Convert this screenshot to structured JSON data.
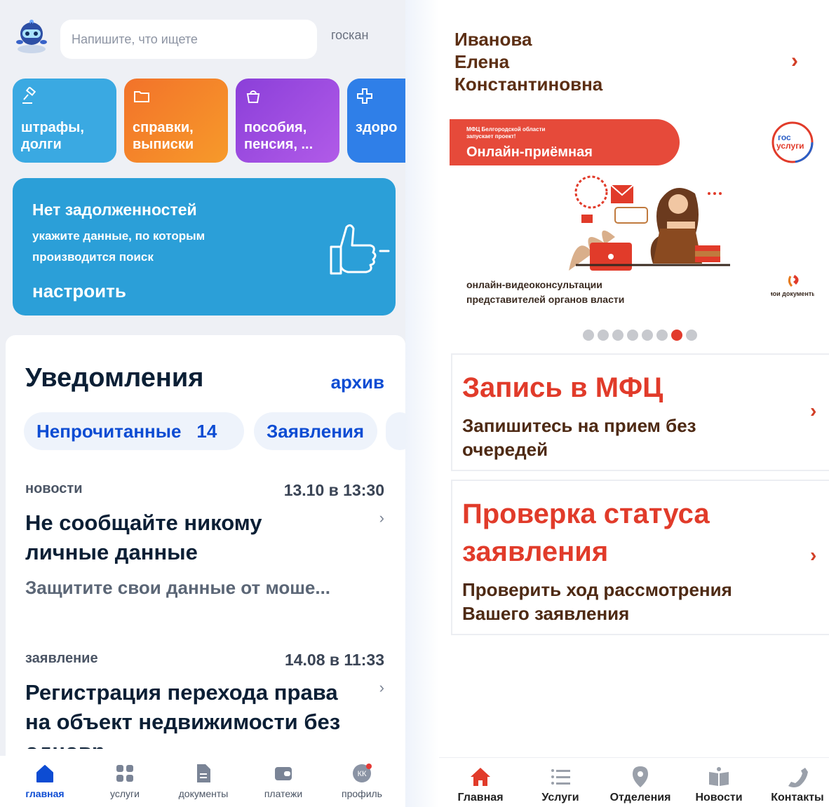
{
  "left": {
    "search": {
      "placeholder": "Напишите, что ищете",
      "scan_label": "госкан"
    },
    "tiles": [
      {
        "label": "штрафы,\nдолги",
        "icon": "gavel-icon"
      },
      {
        "label": "справки,\nвыписки",
        "icon": "folder-icon"
      },
      {
        "label": "пособия,\nпенсия, ...",
        "icon": "purse-icon"
      },
      {
        "label": "здоро",
        "icon": "health-cross-icon"
      }
    ],
    "banner": {
      "title": "Нет задолженностей",
      "subtitle": "укажите данные, по которым производится поиск",
      "action": "настроить"
    },
    "notifications": {
      "title": "Уведомления",
      "archive": "архив",
      "chips": [
        {
          "label": "Непрочитанные",
          "count": "14"
        },
        {
          "label": "Заявления"
        }
      ],
      "items": [
        {
          "category": "новости",
          "date": "13.10 в 13:30",
          "headline": "Не сообщайте никому личные данные",
          "body": "Защитите свои данные от моше..."
        },
        {
          "category": "заявление",
          "date": "14.08 в 11:33",
          "headline": "Регистрация перехода права на объект недвижимости без одновр",
          "body": ""
        }
      ]
    },
    "nav": [
      {
        "label": "главная",
        "icon": "home-icon",
        "active": true
      },
      {
        "label": "услуги",
        "icon": "grid-icon"
      },
      {
        "label": "документы",
        "icon": "document-icon"
      },
      {
        "label": "платежи",
        "icon": "wallet-icon"
      },
      {
        "label": "профиль",
        "icon": "avatar-icon",
        "initials": "КК"
      }
    ],
    "colors": {
      "accent": "#0d4cd3",
      "banner": "#2b9fd8"
    }
  },
  "right": {
    "user": {
      "line1": "Иванова",
      "line2": "Елена",
      "line3": "Константиновна"
    },
    "promo": {
      "small_line1": "МФЦ Белгородской области",
      "small_line2": "запускает проект!",
      "pill_title": "Онлайн-приёмная",
      "caption_line1": "онлайн-видеоконсультации",
      "caption_line2": "представителей органов власти",
      "gos_logo_line1": "гос",
      "gos_logo_line2": "услуги",
      "moi_logo": "мои документы"
    },
    "carousel": {
      "count": 8,
      "active_index": 6
    },
    "cards": [
      {
        "title": "Запись в МФЦ",
        "subtitle": "Запишитесь на прием без очередей"
      },
      {
        "title": "Проверка статуса заявления",
        "subtitle": "Проверить ход рассмотрения Вашего заявления"
      }
    ],
    "nav": [
      {
        "label": "Главная",
        "icon": "home-icon",
        "active": true
      },
      {
        "label": "Услуги",
        "icon": "list-icon"
      },
      {
        "label": "Отделения",
        "icon": "map-pin-icon"
      },
      {
        "label": "Новости",
        "icon": "newspaper-icon"
      },
      {
        "label": "Контакты",
        "icon": "phone-icon"
      }
    ],
    "colors": {
      "accent": "#e13b2a",
      "text_brown": "#4e2a14"
    }
  }
}
